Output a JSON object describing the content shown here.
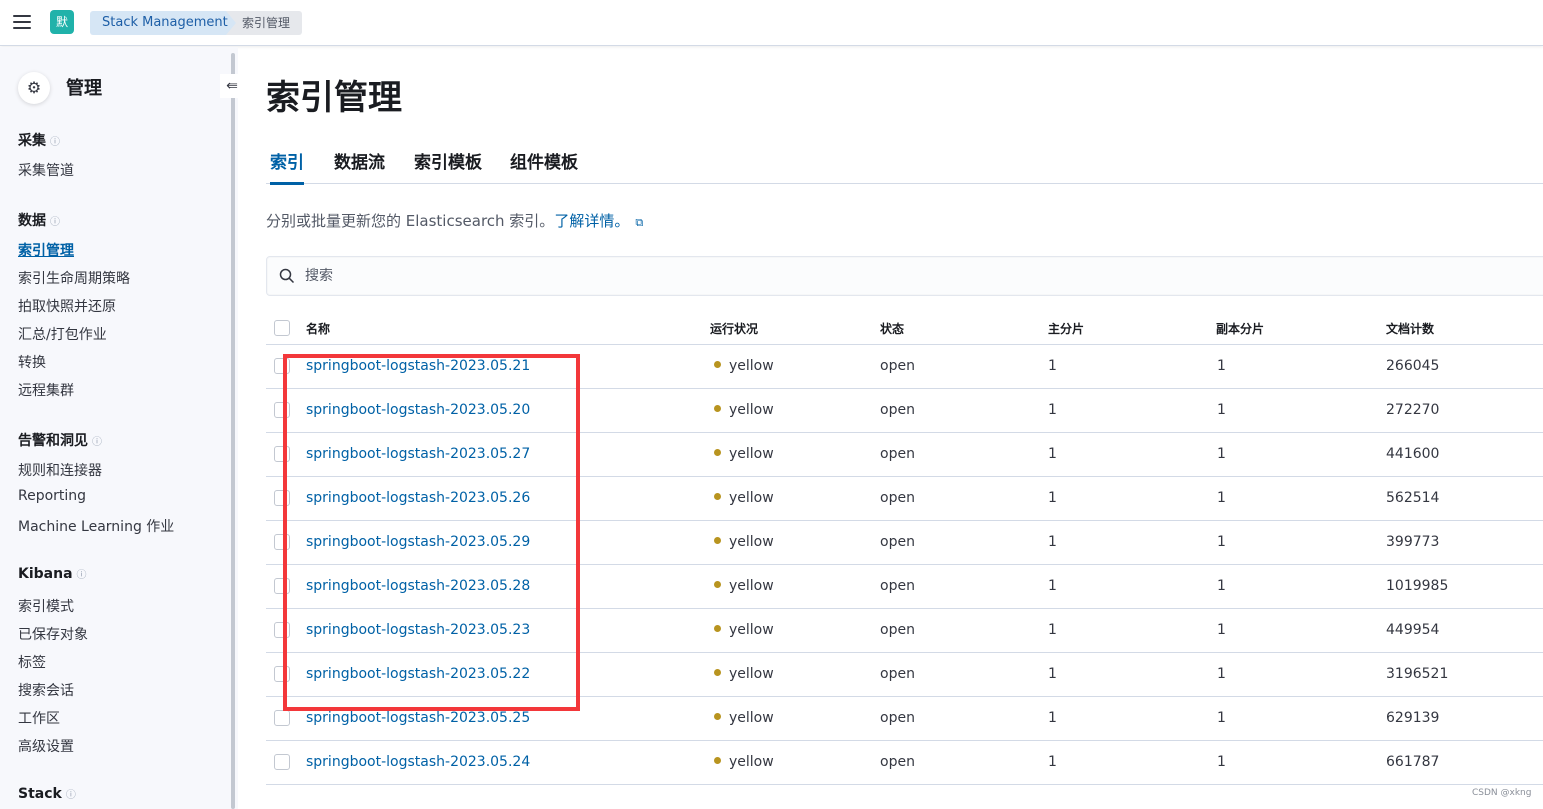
{
  "header": {
    "space_initial": "默",
    "breadcrumbs": [
      "Stack Management",
      "索引管理"
    ]
  },
  "sidebar": {
    "title": "管理",
    "groups": [
      {
        "label": "采集",
        "items": [
          "采集管道"
        ]
      },
      {
        "label": "数据",
        "items": [
          "索引管理",
          "索引生命周期策略",
          "拍取快照并还原",
          "汇总/打包作业",
          "转换",
          "远程集群"
        ]
      },
      {
        "label": "告警和洞见",
        "items": [
          "规则和连接器",
          "Reporting",
          "Machine Learning 作业"
        ]
      },
      {
        "label": "Kibana",
        "items": [
          "索引模式",
          "已保存对象",
          "标签",
          "搜索会话",
          "工作区",
          "高级设置"
        ]
      },
      {
        "label": "Stack",
        "items": []
      }
    ],
    "active_item": "索引管理"
  },
  "main": {
    "title": "索引管理",
    "tabs": [
      "索引",
      "数据流",
      "索引模板",
      "组件模板"
    ],
    "active_tab": "索引",
    "description": "分别或批量更新您的 Elasticsearch 索引。",
    "learn_more": "了解详情。",
    "search_placeholder": "搜索"
  },
  "table": {
    "columns": [
      "名称",
      "运行状况",
      "状态",
      "主分片",
      "副本分片",
      "文档计数"
    ],
    "rows": [
      {
        "name": "springboot-logstash-2023.05.21",
        "health": "yellow",
        "status": "open",
        "primary": "1",
        "replica": "1",
        "docs": "266045"
      },
      {
        "name": "springboot-logstash-2023.05.20",
        "health": "yellow",
        "status": "open",
        "primary": "1",
        "replica": "1",
        "docs": "272270"
      },
      {
        "name": "springboot-logstash-2023.05.27",
        "health": "yellow",
        "status": "open",
        "primary": "1",
        "replica": "1",
        "docs": "441600"
      },
      {
        "name": "springboot-logstash-2023.05.26",
        "health": "yellow",
        "status": "open",
        "primary": "1",
        "replica": "1",
        "docs": "562514"
      },
      {
        "name": "springboot-logstash-2023.05.29",
        "health": "yellow",
        "status": "open",
        "primary": "1",
        "replica": "1",
        "docs": "399773"
      },
      {
        "name": "springboot-logstash-2023.05.28",
        "health": "yellow",
        "status": "open",
        "primary": "1",
        "replica": "1",
        "docs": "1019985"
      },
      {
        "name": "springboot-logstash-2023.05.23",
        "health": "yellow",
        "status": "open",
        "primary": "1",
        "replica": "1",
        "docs": "449954"
      },
      {
        "name": "springboot-logstash-2023.05.22",
        "health": "yellow",
        "status": "open",
        "primary": "1",
        "replica": "1",
        "docs": "3196521"
      },
      {
        "name": "springboot-logstash-2023.05.25",
        "health": "yellow",
        "status": "open",
        "primary": "1",
        "replica": "1",
        "docs": "629139"
      },
      {
        "name": "springboot-logstash-2023.05.24",
        "health": "yellow",
        "status": "open",
        "primary": "1",
        "replica": "1",
        "docs": "661787"
      }
    ]
  },
  "colors": {
    "health_yellow": "#b8941f",
    "accent": "#0061a6",
    "highlight": "#f3373a"
  },
  "watermark": "CSDN @xkng"
}
